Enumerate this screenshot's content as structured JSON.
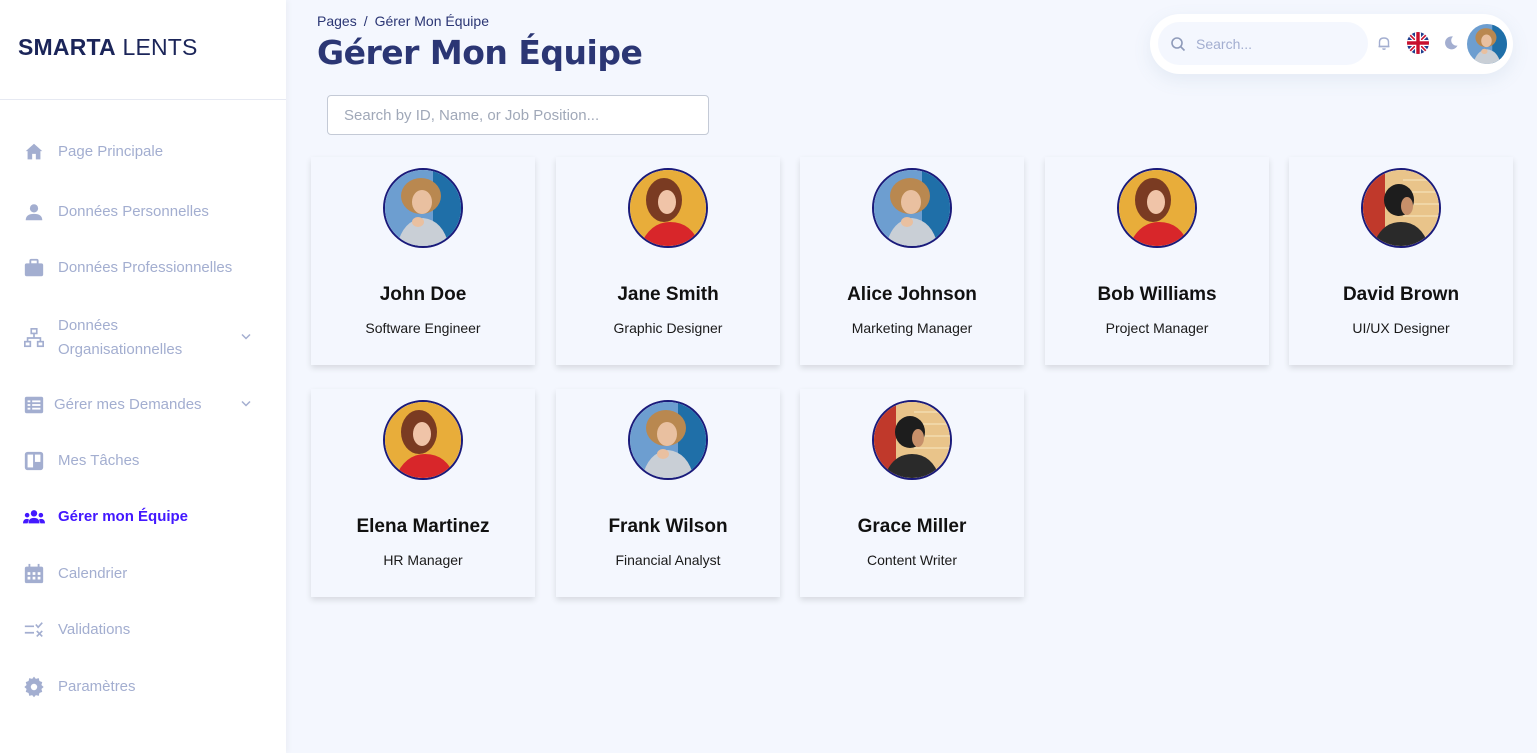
{
  "brand": {
    "bold": "SMARTA",
    "light": " LENTS"
  },
  "sidebar": {
    "items": [
      {
        "label": "Page Principale",
        "icon": "home-icon"
      },
      {
        "label": "Données Personnelles",
        "icon": "person-icon"
      },
      {
        "label": "Données Professionnelles",
        "icon": "briefcase-icon"
      },
      {
        "label": "Données Organisationnelles",
        "icon": "org-chart-icon"
      },
      {
        "label": "Gérer mes Demandes",
        "icon": "list-icon"
      },
      {
        "label": "Mes Tâches",
        "icon": "board-icon"
      },
      {
        "label": "Gérer mon Équipe",
        "icon": "team-icon"
      },
      {
        "label": "Calendrier",
        "icon": "calendar-icon"
      },
      {
        "label": "Validations",
        "icon": "checklist-icon"
      },
      {
        "label": "Paramètres",
        "icon": "gear-icon"
      }
    ],
    "active": "Gérer mon Équipe"
  },
  "header": {
    "breadcrumb_root": "Pages",
    "breadcrumb_sep": "/",
    "breadcrumb_current": "Gérer Mon Équipe",
    "title": "Gérer Mon Équipe",
    "search_placeholder": "Search..."
  },
  "team_search": {
    "placeholder": "Search by ID, Name, or Job Position..."
  },
  "members": [
    {
      "name": "John Doe",
      "role": "Software Engineer",
      "avatar": "blue-woman"
    },
    {
      "name": "Jane Smith",
      "role": "Graphic Designer",
      "avatar": "yellow-woman"
    },
    {
      "name": "Alice Johnson",
      "role": "Marketing Manager",
      "avatar": "blue-woman"
    },
    {
      "name": "Bob Williams",
      "role": "Project Manager",
      "avatar": "yellow-woman"
    },
    {
      "name": "David Brown",
      "role": "UI/UX Designer",
      "avatar": "red-man"
    },
    {
      "name": "Elena Martinez",
      "role": "HR Manager",
      "avatar": "yellow-woman"
    },
    {
      "name": "Frank Wilson",
      "role": "Financial Analyst",
      "avatar": "blue-woman"
    },
    {
      "name": "Grace Miller",
      "role": "Content Writer",
      "avatar": "red-man"
    }
  ],
  "colors": {
    "accent": "#4318ff",
    "muted": "#a3aed0",
    "title": "#2b3674",
    "background": "#f4f7fe"
  }
}
